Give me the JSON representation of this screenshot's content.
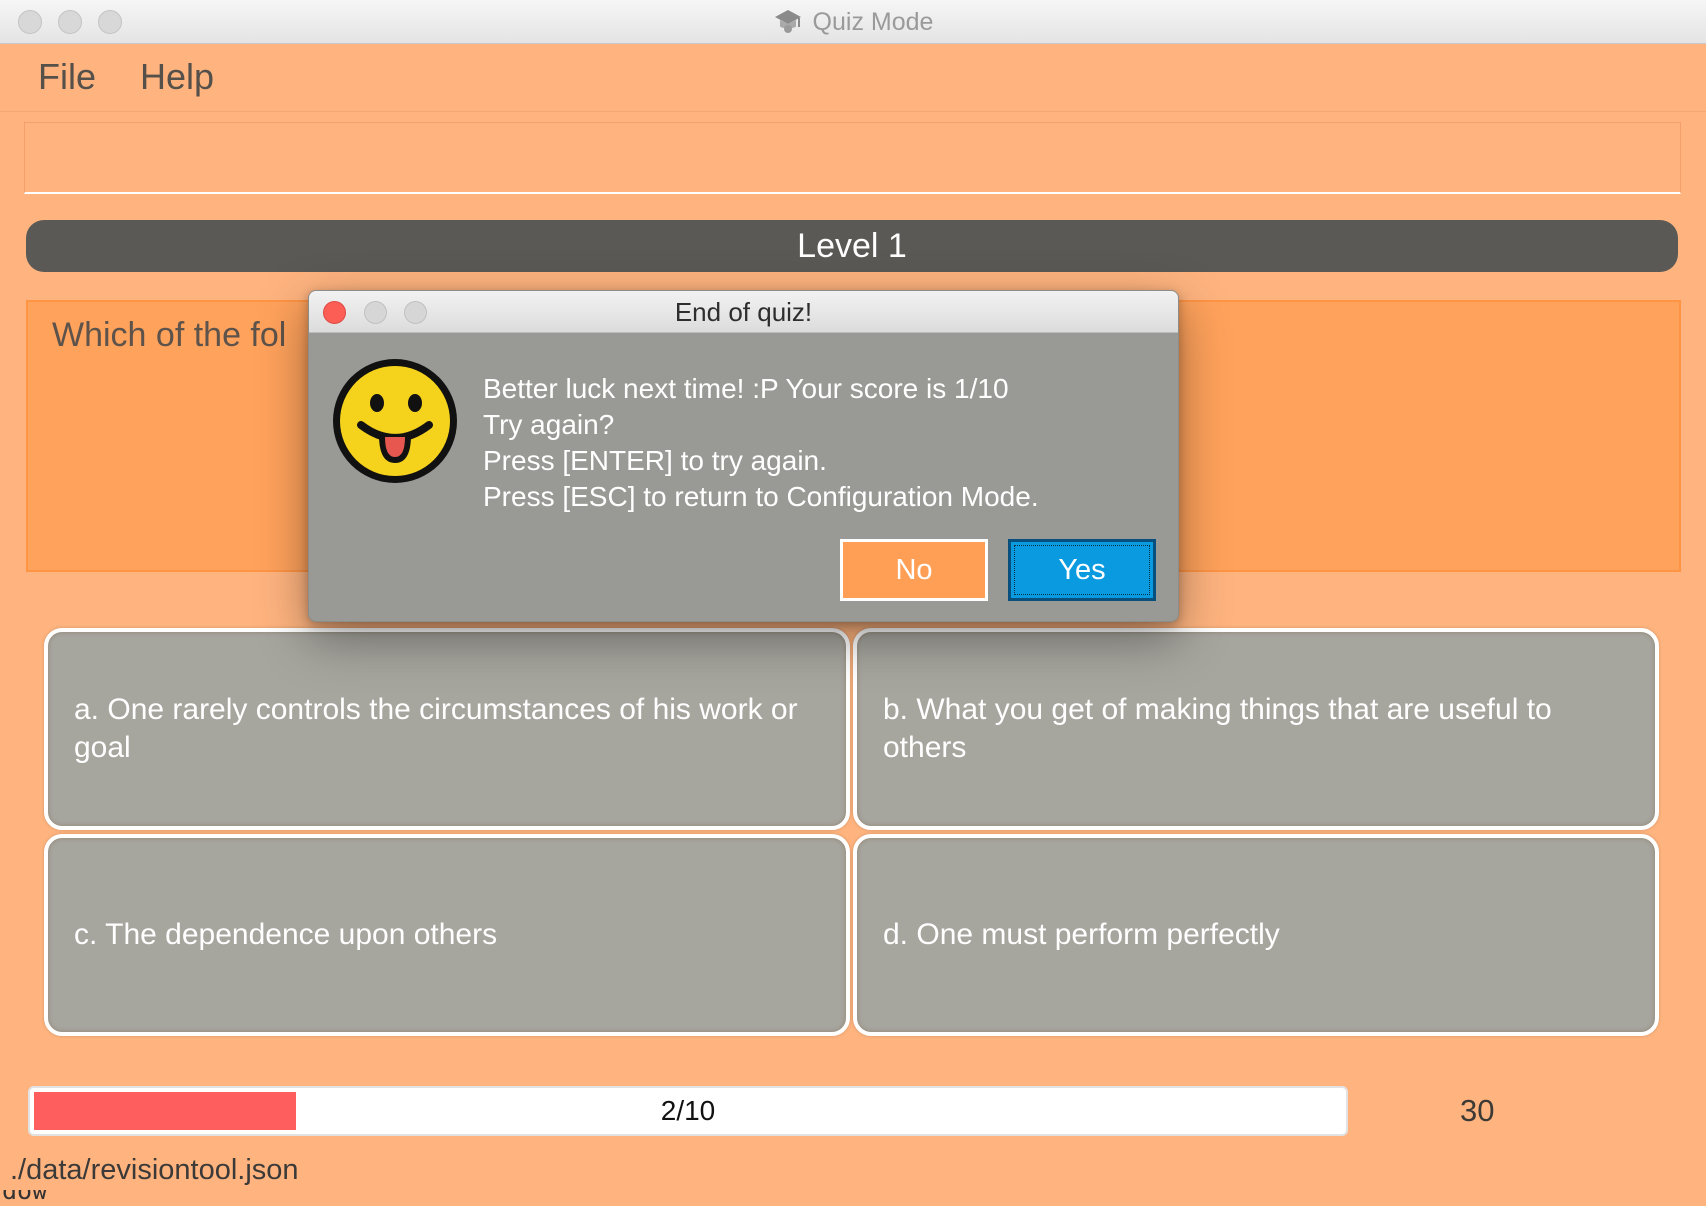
{
  "window": {
    "title": "Quiz Mode",
    "app_icon": "graduation-cap-icon"
  },
  "menu": {
    "items": [
      "File",
      "Help"
    ]
  },
  "command_box": {
    "value": ""
  },
  "level": {
    "label": "Level 1"
  },
  "question": {
    "text_visible": "Which of the fol"
  },
  "options": [
    {
      "text": "a. One rarely controls the circumstances of his work or goal"
    },
    {
      "text": "b. What you get of making things that are useful to others"
    },
    {
      "text": "c. The dependence upon others"
    },
    {
      "text": "d. One must perform perfectly"
    }
  ],
  "progress": {
    "label": "2/10",
    "fraction": 0.2,
    "fill_color": "#ff5e5e"
  },
  "timer": {
    "value": "30"
  },
  "status": {
    "path": "./data/revisiontool.json",
    "clipped_log": "dow executeCommand"
  },
  "dialog": {
    "title": "End of quiz!",
    "icon": "tongue-out-emoji-icon",
    "lines": [
      "Better luck next time! :P Your score is 1/10",
      "Try again?",
      "Press [ENTER] to try again.",
      "Press [ESC] to return to Configuration Mode."
    ],
    "buttons": {
      "no": "No",
      "yes": "Yes"
    }
  },
  "colors": {
    "background": "#ffb47f",
    "accent": "#ffa25c",
    "level_bar": "#5a5955",
    "option_bg": "#a6a59e",
    "yes_button": "#0a9ae0"
  }
}
